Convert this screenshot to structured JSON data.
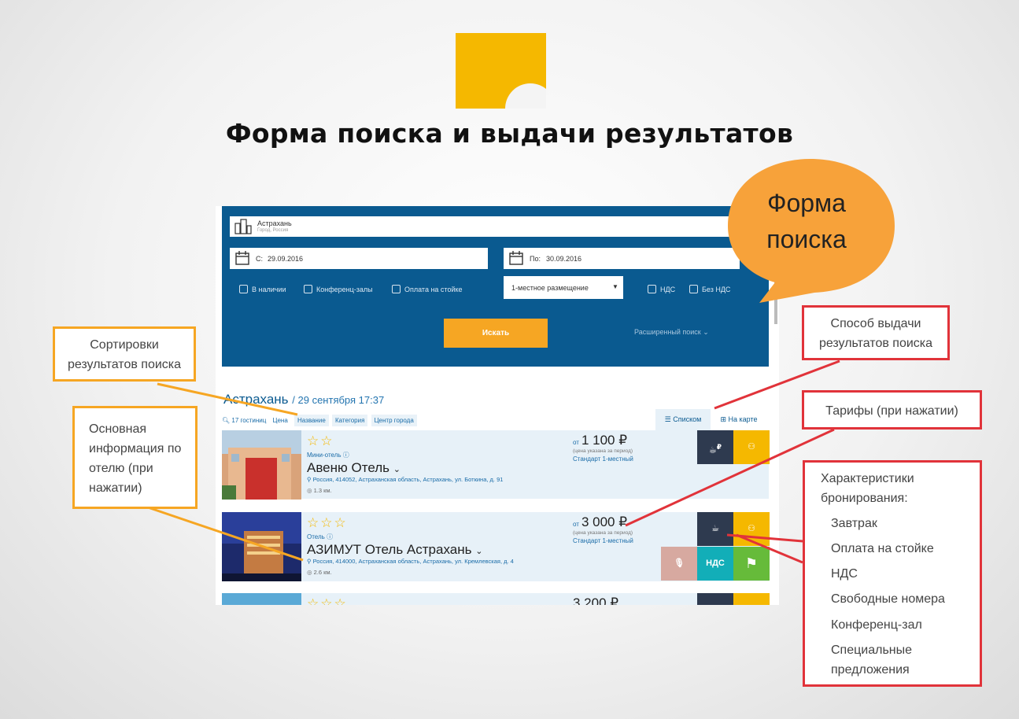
{
  "slide": {
    "title": "Форма поиска и выдачи результатов"
  },
  "search_form": {
    "city_value": "Астрахань",
    "city_hint": "Город, Россия",
    "date_from_label": "С:",
    "date_from": "29.09.2016",
    "date_to_label": "По:",
    "date_to": "30.09.2016",
    "checkboxes": [
      "В наличии",
      "Конференц-залы",
      "Оплата на стойке",
      "НДС",
      "Без НДС"
    ],
    "room_select": "1-местное размещение",
    "search_button": "Искать",
    "advanced_link": "Расширенный поиск"
  },
  "results": {
    "city": "Астрахань",
    "date": "/ 29 сентября 17:37",
    "count": "17 гостиниц",
    "sort_label": "Цена",
    "sort_options": [
      "Название",
      "Категория",
      "Центр города"
    ],
    "view_list": "Списком",
    "view_map": "На карте",
    "price_prefix": "от",
    "price_note": "(цена указана за период)",
    "hotels": [
      {
        "type": "Мини-отель",
        "name": "Авеню Отель",
        "address": "Россия, 414052, Астраханская область, Астрахань, ул. Боткина, д. 91",
        "distance": "1.3 км.",
        "price": "1 100 ₽",
        "tariff": "Стандарт 1-местный",
        "stars": 2
      },
      {
        "type": "Отель",
        "name": "АЗИМУТ Отель Астрахань",
        "address": "Россия, 414000, Астраханская область, Астрахань, ул. Кремлевская, д. 4",
        "distance": "2.6 км.",
        "price": "3 000 ₽",
        "tariff": "Стандарт 1-местный",
        "stars": 3
      },
      {
        "price": "3 200 ₽",
        "stars": 3
      }
    ],
    "vat_tile": "НДС"
  },
  "annotations": {
    "bubble": "Форма поиска",
    "sort_note": "Сортировки результатов поиска",
    "info_note": "Основная информация по отелю (при нажатии)",
    "view_note": "Способ выдачи результатов поиска",
    "tariff_note": "Тарифы (при нажатии)",
    "features_title": "Характеристики бронирования:",
    "features": [
      "Завтрак",
      "Оплата на стойке",
      "НДС",
      "Свободные номера",
      "Конференц-зал",
      "Специальные предложения"
    ]
  },
  "colors": {
    "brand_yellow": "#f5b800",
    "panel_blue": "#0a5a90",
    "button_orange": "#f6a623",
    "note_orange": "#f6a623",
    "note_red": "#e1333a",
    "tile_dark": "#2e3a4f",
    "tile_yellow": "#f5b800",
    "tile_teal": "#12aeb8",
    "tile_green": "#66bb3a",
    "tile_pink": "#d7a9a0"
  }
}
